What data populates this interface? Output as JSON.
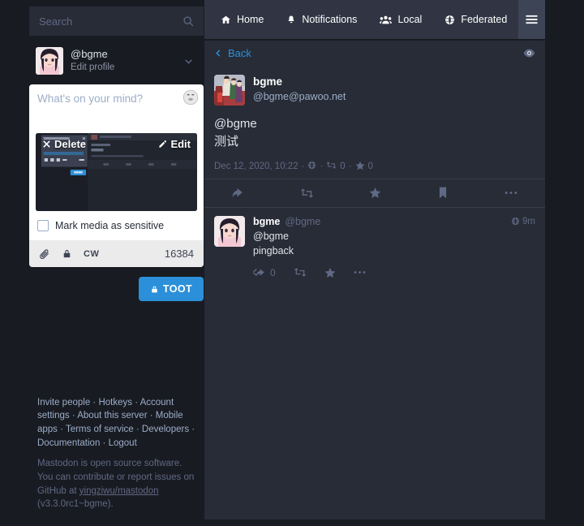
{
  "search": {
    "placeholder": "Search",
    "value": "",
    "icon": "search-icon"
  },
  "account": {
    "username": "@bgme",
    "edit_profile": "Edit profile",
    "chevron": "chevron-down-icon"
  },
  "compose": {
    "placeholder": "What's on your mind?",
    "emoji_icon": "grinning-face-icon",
    "media": {
      "delete_label": "Delete",
      "edit_label": "Edit",
      "delete_icon": "close-icon",
      "edit_icon": "pencil-icon"
    },
    "sensitive_label": "Mark media as sensitive",
    "sensitive_checked": false,
    "footer": {
      "attach_icon": "paperclip-icon",
      "privacy_icon": "lock-icon",
      "cw_label": "CW",
      "char_count": "16384"
    },
    "toot_label": "TOOT",
    "toot_icon": "lock-icon",
    "toot_color": "#2b90d9"
  },
  "drawer_footer": {
    "links": [
      "Invite people",
      "Hotkeys",
      "Account settings",
      "About this server",
      "Mobile apps",
      "Terms of service",
      "Developers",
      "Documentation",
      "Logout"
    ],
    "separator": " · ",
    "note_pre": "Mastodon is open source software. You can contribute or report issues on GitHub at ",
    "note_link": "yingziwu/mastodon",
    "note_post": " (v3.3.0rc1~bgme)."
  },
  "nav": {
    "tabs": [
      {
        "label": "Home",
        "icon": "home-icon"
      },
      {
        "label": "Notifications",
        "icon": "bell-icon"
      },
      {
        "label": "Local",
        "icon": "users-icon"
      },
      {
        "label": "Federated",
        "icon": "globe-icon"
      }
    ],
    "menu_icon": "hamburger-icon"
  },
  "column": {
    "back_label": "Back",
    "back_icon": "chevron-left-icon",
    "eye_icon": "eye-icon"
  },
  "detailed_status": {
    "display_name": "bgme",
    "acct": "@bgme@pawoo.net",
    "content_line1": "@bgme",
    "content_line2": "测试",
    "timestamp": "Dec 12, 2020, 10:22",
    "visibility_icon": "globe-icon",
    "boost_icon": "boost-icon",
    "boost_count": "0",
    "fav_icon": "star-icon",
    "fav_count": "0",
    "separator": "·"
  },
  "action_bar": [
    {
      "name": "reply-button",
      "icon": "reply-icon"
    },
    {
      "name": "boost-button",
      "icon": "boost-icon"
    },
    {
      "name": "favourite-button",
      "icon": "star-icon"
    },
    {
      "name": "bookmark-button",
      "icon": "bookmark-icon"
    },
    {
      "name": "more-button",
      "icon": "ellipsis-icon"
    }
  ],
  "reply_status": {
    "display_name": "bgme",
    "acct": "@bgme",
    "time": "9m",
    "visibility_icon": "globe-icon",
    "content_line1": "@bgme",
    "content_line2": "pingback",
    "actions": {
      "reply_icon": "reply-all-icon",
      "reply_count": "0",
      "boost_icon": "boost-icon",
      "fav_icon": "star-icon",
      "more_icon": "ellipsis-icon"
    }
  },
  "colors": {
    "page_bg": "#191b22",
    "column_bg": "#282c37",
    "tab_bg": "#313543",
    "accent": "#2b90d9",
    "text_primary": "#ffffff",
    "text_muted": "#606984"
  }
}
